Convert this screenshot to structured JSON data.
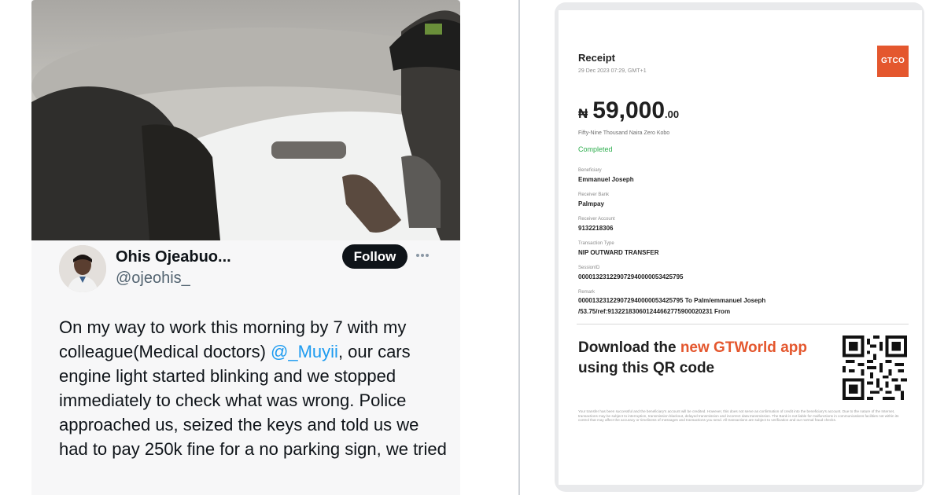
{
  "tweet": {
    "author_name": "Ohis Ojeabuo...",
    "author_handle": "@ojeohis_",
    "follow_label": "Follow",
    "more_icon": "more-horizontal-icon",
    "text_part1": "On my way to work this morning by 7 with my colleague(Medical doctors) ",
    "mention": "@_Muyii",
    "text_part2": ", our cars engine light started blinking and we stopped immediately to check what was wrong. Police approached us, seized the keys and told us we had to pay 250k fine for a no parking sign, we tried"
  },
  "receipt": {
    "title": "Receipt",
    "date": "29 Dec 2023 07:29, GMT+1",
    "logo_text": "GTCO",
    "currency": "₦",
    "amount": "59,000",
    "kobo": ".00",
    "amount_words": "Fifty-Nine Thousand Naira Zero Kobo",
    "status": "Completed",
    "fields": [
      {
        "label": "Beneficiary",
        "value": "Emmanuel Joseph"
      },
      {
        "label": "Receiver Bank",
        "value": "Palmpay"
      },
      {
        "label": "Receiver Account",
        "value": "9132218306"
      },
      {
        "label": "Transaction Type",
        "value": "NIP OUTWARD TRANSFER"
      },
      {
        "label": "SessionID",
        "value": "000013231229072940000053425795"
      },
      {
        "label": "Remark",
        "value": "000013231229072940000053425795 To Palm/emmanuel Joseph /53.75/ref:913221830601244662775900020231 From"
      }
    ],
    "download_part1": "Download the ",
    "download_accent": "new GTWorld app",
    "download_part2": " using this QR code",
    "disclaimer": "Your transfer has been successful and the beneficiary's account will be credited. However, this does not serve as confirmation of credit into the beneficiary's account. Due to the nature of the Internet, transactions may be subject to interruption, transmission blackout, delayed transmission and incorrect data transmission. The Bank is not liable for malfunctions in communications facilities not within its control that may affect the accuracy or timeliness of messages and transactions you send. All transactions are subject to verification and our normal fraud checks.",
    "colors": {
      "accent": "#e4572e",
      "status": "#2fae4f"
    }
  }
}
